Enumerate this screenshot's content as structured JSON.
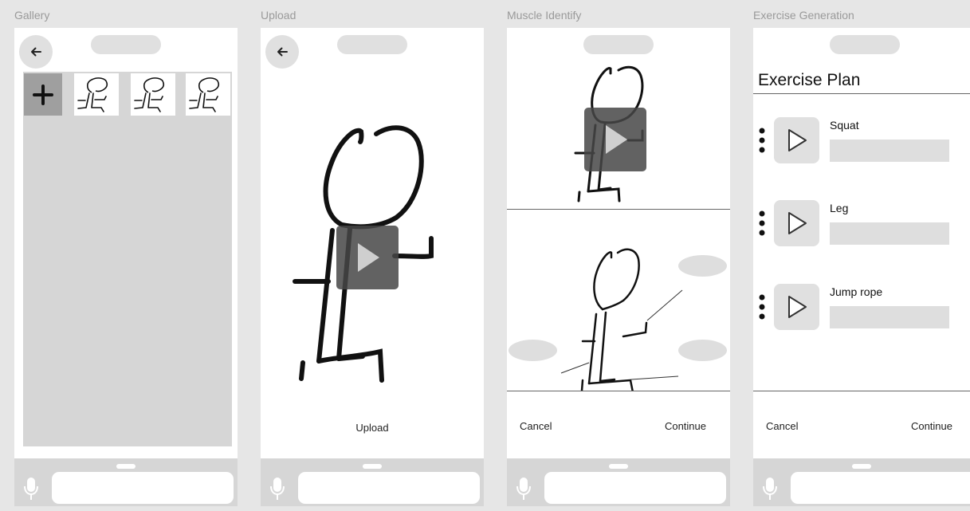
{
  "frames": {
    "gallery": {
      "label": "Gallery"
    },
    "upload": {
      "label": "Upload",
      "upload_label": "Upload"
    },
    "muscle": {
      "label": "Muscle Identify",
      "cancel_label": "Cancel",
      "continue_label": "Continue"
    },
    "exercise": {
      "label": "Exercise Generation",
      "title": "Exercise Plan",
      "items": [
        {
          "label": "Squat"
        },
        {
          "label": "Leg"
        },
        {
          "label": "Jump rope"
        }
      ],
      "cancel_label": "Cancel",
      "continue_label": "Continue"
    }
  },
  "icons": {
    "back": "back-arrow-icon",
    "add": "plus-icon",
    "play": "play-icon",
    "mic": "microphone-icon",
    "more": "vertical-dots-icon"
  },
  "colors": {
    "background": "#e6e6e6",
    "panel": "#ffffff",
    "placeholder": "#e0e0e0",
    "gallery_area": "#d6d6d6",
    "add_tile": "#9f9f9f",
    "play_overlay": "#5f5f5f"
  }
}
